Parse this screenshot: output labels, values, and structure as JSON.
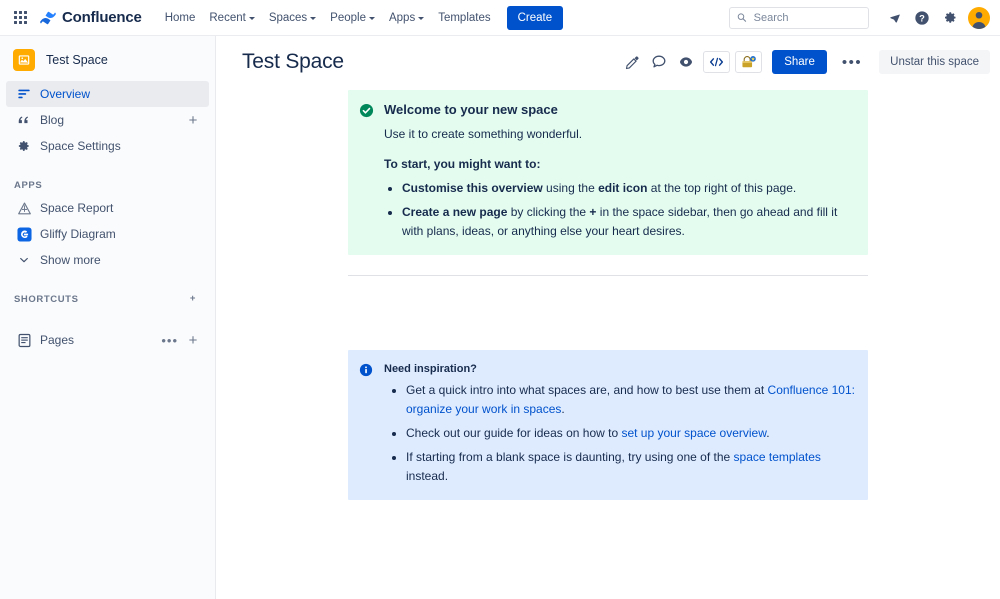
{
  "topnav": {
    "app_switcher_icon": "grid-apps-icon",
    "brand": "Confluence",
    "links": [
      {
        "label": "Home",
        "has_caret": false
      },
      {
        "label": "Recent",
        "has_caret": true
      },
      {
        "label": "Spaces",
        "has_caret": true
      },
      {
        "label": "People",
        "has_caret": true
      },
      {
        "label": "Apps",
        "has_caret": true
      },
      {
        "label": "Templates",
        "has_caret": false
      }
    ],
    "create_label": "Create",
    "search_placeholder": "Search",
    "search_value": "",
    "icons": [
      "search-icon",
      "notifications-bell-icon",
      "help-question-icon",
      "settings-gear-icon",
      "user-avatar"
    ]
  },
  "sidebar": {
    "space_name": "Test Space",
    "space_icon": "space-image-icon",
    "items": [
      {
        "label": "Overview",
        "icon": "overview-lines-icon",
        "active": true,
        "plus": false
      },
      {
        "label": "Blog",
        "icon": "quote-marks-icon",
        "active": false,
        "plus": true
      },
      {
        "label": "Space Settings",
        "icon": "gear-icon",
        "active": false,
        "plus": false
      }
    ],
    "apps_header": "APPS",
    "apps": [
      {
        "label": "Space Report",
        "icon": "space-report-icon"
      },
      {
        "label": "Gliffy Diagram",
        "icon": "gliffy-icon"
      },
      {
        "label": "Show more",
        "icon": "chevron-down-icon"
      }
    ],
    "shortcuts_header": "SHORTCUTS",
    "shortcuts": [
      {
        "label": "Pages",
        "icon": "pages-document-icon"
      }
    ]
  },
  "main": {
    "title": "Test Space",
    "actions": {
      "edit_icon": "pencil-edit-icon",
      "comment_icon": "comment-bubble-icon",
      "watch_icon": "eye-watch-icon",
      "code_icon": "code-brackets-icon",
      "app_icon": "app-badge-icon",
      "share_label": "Share",
      "more_label": "•••",
      "unstar_label": "Unstar this space"
    },
    "welcome_panel": {
      "icon": "success-check-icon",
      "title": "Welcome to your new space",
      "subtitle": "Use it to create something wonderful.",
      "cta": "To start, you might want to:",
      "bullets": [
        {
          "parts": [
            {
              "text": "Customise this overview",
              "bold": true
            },
            {
              "text": " using the ",
              "bold": false
            },
            {
              "text": "edit icon",
              "bold": true
            },
            {
              "text": " at the top right of this page.",
              "bold": false
            }
          ]
        },
        {
          "parts": [
            {
              "text": "Create a new page",
              "bold": true
            },
            {
              "text": " by clicking the ",
              "bold": false
            },
            {
              "text": "+",
              "bold": true
            },
            {
              "text": " in the space sidebar, then go ahead and fill it with plans, ideas, or anything else your heart desires.",
              "bold": false
            }
          ]
        }
      ]
    },
    "inspiration_panel": {
      "icon": "info-circle-icon",
      "title": "Need inspiration?",
      "bullets": [
        {
          "parts": [
            {
              "text": "Get a quick intro into what spaces are, and how to best use them at ",
              "link": false
            },
            {
              "text": "Confluence 101: organize your work in spaces",
              "link": true
            },
            {
              "text": ".",
              "link": false
            }
          ]
        },
        {
          "parts": [
            {
              "text": "Check out our guide for ideas on how to ",
              "link": false
            },
            {
              "text": "set up your space overview",
              "link": true
            },
            {
              "text": ".",
              "link": false
            }
          ]
        },
        {
          "parts": [
            {
              "text": "If starting from a blank space is daunting, try using one of the ",
              "link": false
            },
            {
              "text": "space templates",
              "link": true
            },
            {
              "text": " instead.",
              "link": false
            }
          ]
        }
      ]
    }
  },
  "colors": {
    "brand_blue": "#0052cc",
    "green_panel": "#e3fcef",
    "blue_panel": "#deebff",
    "sidebar_bg": "#fafbfc",
    "text": "#172b4d",
    "avatar_orange": "#ffab00"
  }
}
